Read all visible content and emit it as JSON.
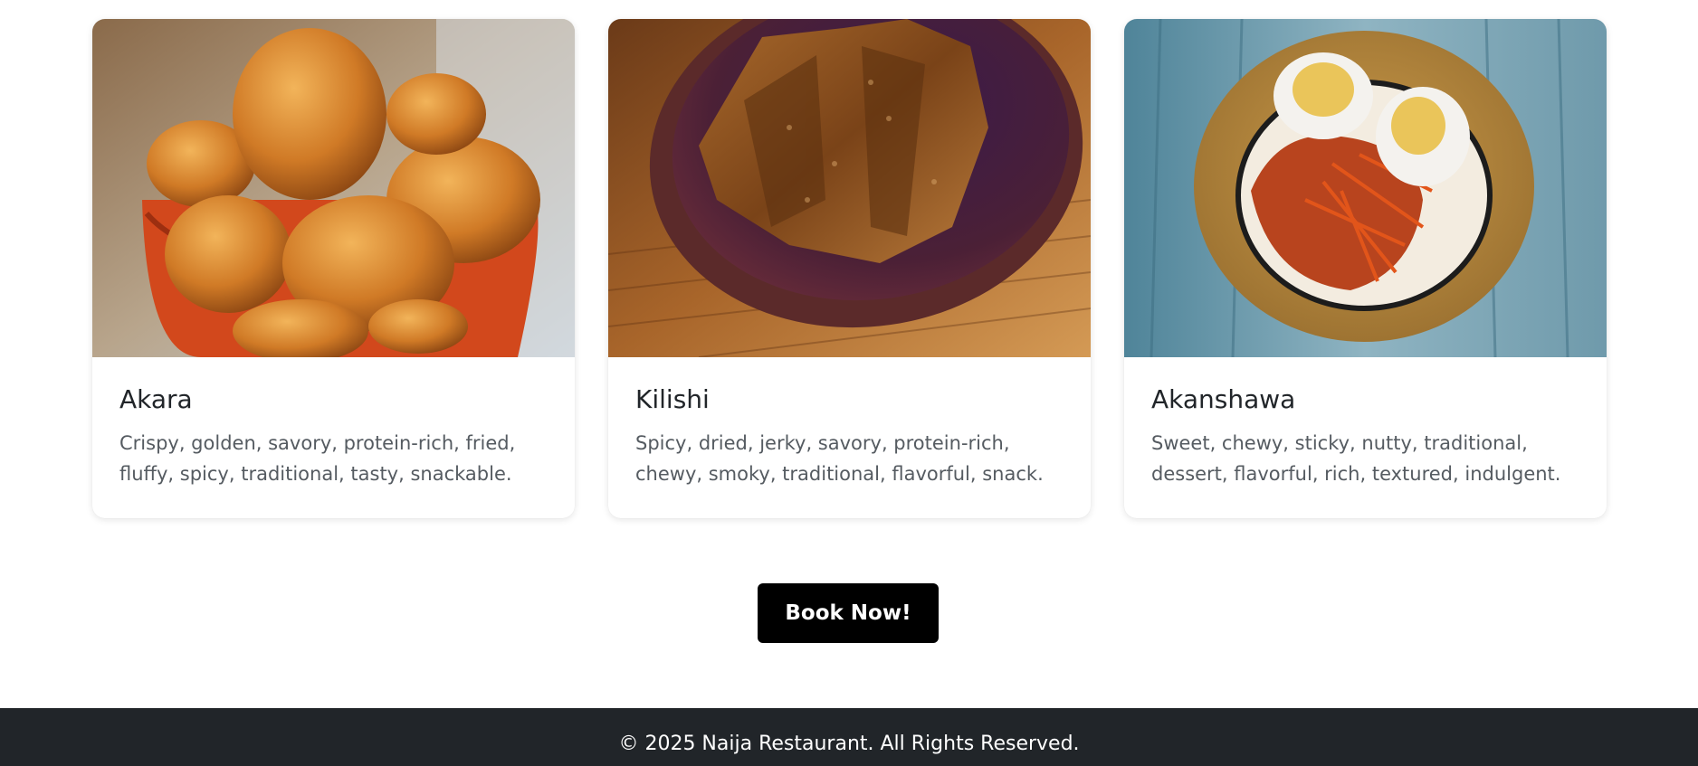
{
  "menu": {
    "items": [
      {
        "name": "Akara",
        "description": "Crispy, golden, savory, protein-rich, fried, fluffy, spicy, traditional, tasty, snackable.",
        "image": "akara-bowl-photo"
      },
      {
        "name": "Kilishi",
        "description": "Spicy, dried, jerky, savory, protein-rich, chewy, smoky, traditional, flavorful, snack.",
        "image": "kilishi-bowl-photo"
      },
      {
        "name": "Akanshawa",
        "description": "Sweet, chewy, sticky, nutty, traditional, dessert, flavorful, rich, textured, indulgent.",
        "image": "akanshawa-bowl-photo"
      }
    ]
  },
  "cta": {
    "book_label": "Book Now!"
  },
  "footer": {
    "copyright": "© 2025 Naija Restaurant. All Rights Reserved."
  },
  "colors": {
    "footer_bg": "#212529",
    "button_bg": "#000000",
    "title_text": "#212529",
    "body_text": "#555b61"
  }
}
